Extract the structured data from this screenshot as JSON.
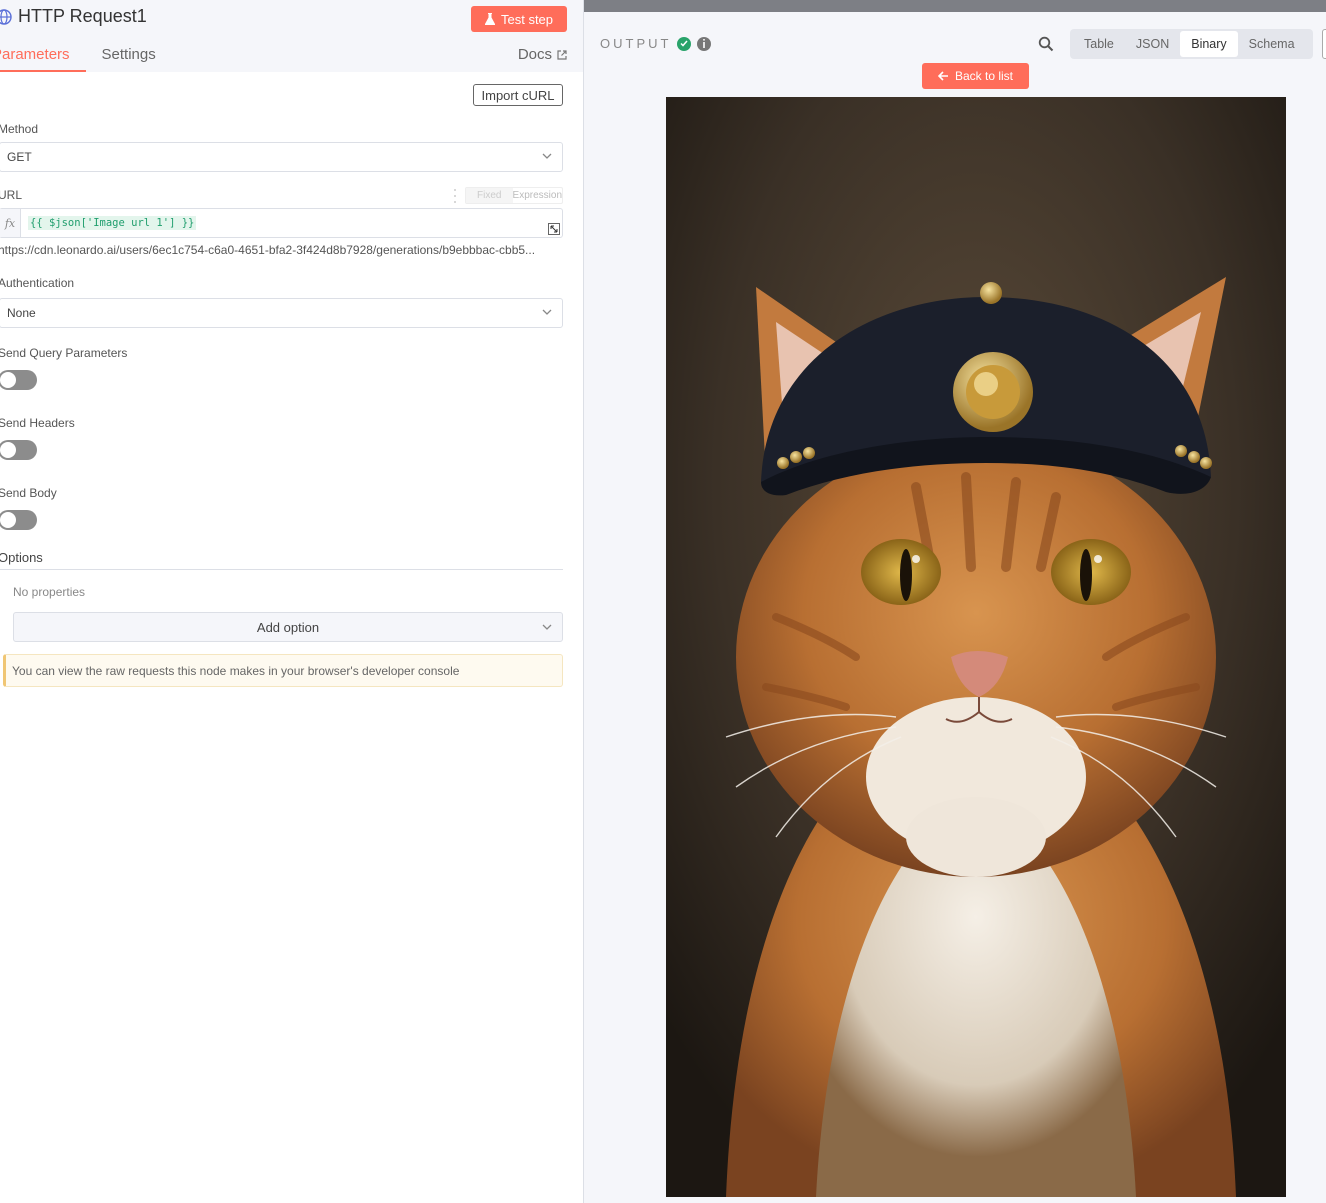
{
  "node": {
    "title": "HTTP Request1",
    "test_step_label": "Test step"
  },
  "tabs": [
    {
      "label": "Parameters"
    },
    {
      "label": "Settings"
    }
  ],
  "docs_label": "Docs",
  "import_curl_label": "Import cURL",
  "method": {
    "label": "Method",
    "value": "GET"
  },
  "url": {
    "label": "URL",
    "mode_fixed": "Fixed",
    "mode_expression": "Expression",
    "fx": "fx",
    "expression": "{{ $json['Image url 1'] }}",
    "preview": "https://cdn.leonardo.ai/users/6ec1c754-c6a0-4651-bfa2-3f424d8b7928/generations/b9ebbbac-cbb5..."
  },
  "authentication": {
    "label": "Authentication",
    "value": "None"
  },
  "send_query": {
    "label": "Send Query Parameters"
  },
  "send_headers": {
    "label": "Send Headers"
  },
  "send_body": {
    "label": "Send Body"
  },
  "options": {
    "label": "Options",
    "empty": "No properties",
    "add_label": "Add option"
  },
  "notice": "You can view the raw requests this node makes in your browser's developer console",
  "output": {
    "label": "OUTPUT",
    "views": [
      {
        "label": "Table"
      },
      {
        "label": "JSON"
      },
      {
        "label": "Binary"
      },
      {
        "label": "Schema"
      }
    ],
    "active_view": "Binary",
    "back_label": "Back to list"
  },
  "colors": {
    "accent": "#ff6d5a",
    "success": "#29a36a",
    "expression": "#1f9e6d"
  }
}
